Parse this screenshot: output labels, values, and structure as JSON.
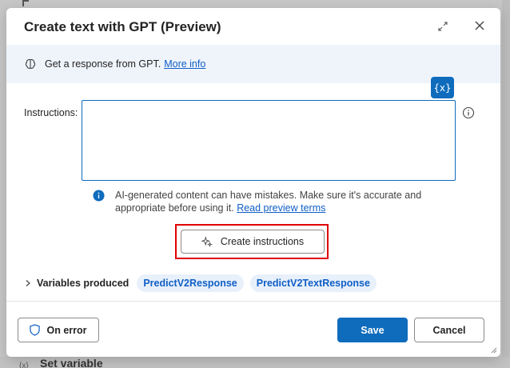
{
  "background": {
    "bottom_label": "Set variable",
    "bottom_icon": "{x}"
  },
  "dialog": {
    "title": "Create text with GPT (Preview)",
    "expand_icon": "expand-icon",
    "close_icon": "close-icon"
  },
  "banner": {
    "icon": "brain-icon",
    "text": "Get a response from GPT.",
    "link": "More info"
  },
  "variable_button": "{x}",
  "instructions": {
    "label": "Instructions:",
    "value": "",
    "help_icon": "info-circle-icon"
  },
  "notice": {
    "text": "AI-generated content can have mistakes. Make sure it's accurate and appropriate before using it.",
    "link": "Read preview terms"
  },
  "create_button": {
    "label": "Create instructions",
    "icon": "sparkle-icon"
  },
  "variables": {
    "label": "Variables produced",
    "items": [
      "PredictV2Response",
      "PredictV2TextResponse"
    ]
  },
  "footer": {
    "on_error": "On error",
    "save": "Save",
    "cancel": "Cancel"
  },
  "colors": {
    "accent": "#0f6cbd",
    "banner_bg": "#eff4fb",
    "highlight": "#e00000"
  }
}
